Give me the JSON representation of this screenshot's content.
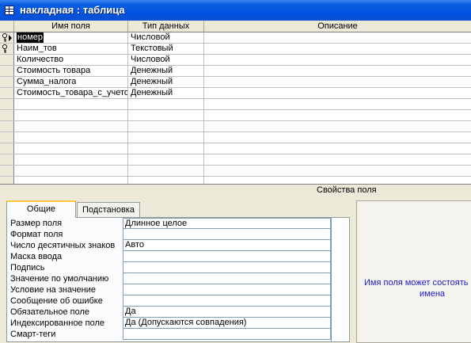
{
  "window": {
    "title": "накладная : таблица"
  },
  "grid": {
    "columns": [
      "Имя поля",
      "Тип данных",
      "Описание"
    ],
    "rows": [
      {
        "name": "номер",
        "type": "Числовой",
        "description": ""
      },
      {
        "name": "Наим_тов",
        "type": "Текстовый",
        "description": ""
      },
      {
        "name": "Количество",
        "type": "Числовой",
        "description": ""
      },
      {
        "name": "Стоимость товара",
        "type": "Денежный",
        "description": ""
      },
      {
        "name": "Сумма_налога",
        "type": "Денежный",
        "description": ""
      },
      {
        "name": "Стоимость_товара_с_учетом",
        "type": "Денежный",
        "description": ""
      }
    ]
  },
  "section_label": "Свойства поля",
  "tabs": [
    "Общие",
    "Подстановка"
  ],
  "properties": [
    {
      "label": "Размер поля",
      "value": "Длинное целое"
    },
    {
      "label": "Формат поля",
      "value": ""
    },
    {
      "label": "Число десятичных знаков",
      "value": "Авто"
    },
    {
      "label": "Маска ввода",
      "value": ""
    },
    {
      "label": "Подпись",
      "value": ""
    },
    {
      "label": "Значение по умолчанию",
      "value": ""
    },
    {
      "label": "Условие на значение",
      "value": ""
    },
    {
      "label": "Сообщение об ошибке",
      "value": ""
    },
    {
      "label": "Обязательное поле",
      "value": "Да"
    },
    {
      "label": "Индексированное поле",
      "value": "Да (Допускаются совпадения)"
    },
    {
      "label": "Смарт-теги",
      "value": ""
    }
  ],
  "hint": {
    "line1": "Имя поля может состоять",
    "line2": "имена"
  },
  "colors": {
    "title_bar": "#0054e3",
    "tab_highlight": "#ffc83c",
    "hint_text": "#1a1ac8"
  }
}
